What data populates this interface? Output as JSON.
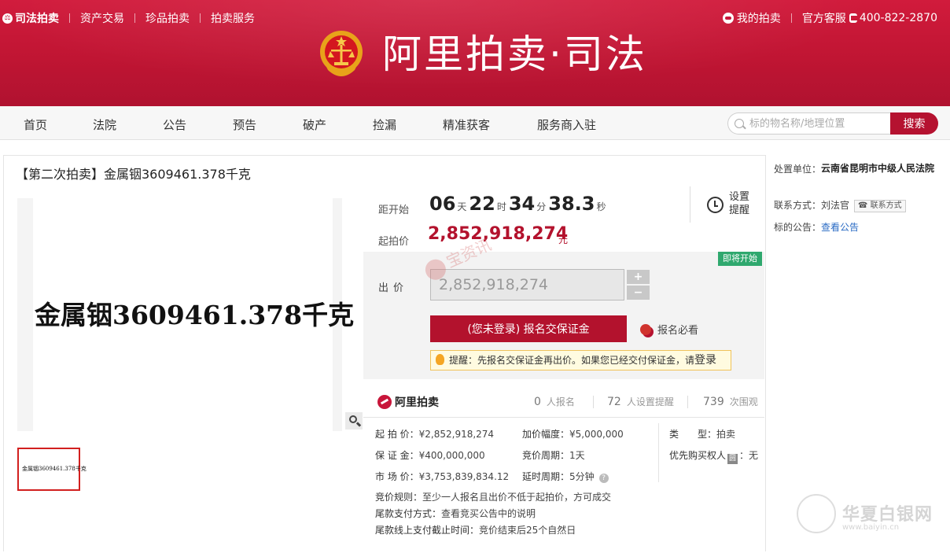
{
  "top_links": {
    "brand": "司法拍卖",
    "items": [
      "资产交易",
      "珍品拍卖",
      "拍卖服务"
    ]
  },
  "top_right": {
    "my_auction": "我的拍卖",
    "service": "官方客服",
    "phone": "400-822-2870"
  },
  "logo_title": "阿里拍卖·司法",
  "nav": [
    "首页",
    "法院",
    "公告",
    "预告",
    "破产",
    "捡漏",
    "精准获客",
    "服务商入驻"
  ],
  "search": {
    "placeholder": "标的物名称/地理位置",
    "button": "搜索"
  },
  "item": {
    "title": "【第二次拍卖】金属铟3609461.378千克",
    "image_text": "金属铟3609461.378千克",
    "thumb_text": "金属铟3609461.378千克"
  },
  "countdown": {
    "label": "距开始",
    "days": "06",
    "days_unit": "天",
    "hours": "22",
    "hours_unit": "时",
    "minutes": "34",
    "minutes_unit": "分",
    "seconds": "38.3",
    "seconds_unit": "秒"
  },
  "reminder": "设置提醒",
  "start_price": {
    "label": "起拍价",
    "value": "2,852,918,274",
    "unit": "元"
  },
  "status_badge": "即将开始",
  "bid": {
    "label": "出价",
    "value": "2,852,918,274",
    "plus": "+",
    "minus": "−"
  },
  "watermark_text": "宝资讯",
  "register_button": "(您未登录) 报名交保证金",
  "must_read": "报名必看",
  "tip": {
    "prefix": "提醒：",
    "text": "先报名交保证金再出价。如果您已经交付保证金，请",
    "link": "登录"
  },
  "ali_logo": "阿里拍卖",
  "stats": [
    {
      "num": "0",
      "label": "人报名"
    },
    {
      "num": "72",
      "label": "人设置提醒"
    },
    {
      "num": "739",
      "label": "次围观"
    }
  ],
  "info": {
    "start_price": {
      "k": "起 拍 价：",
      "v": "¥2,852,918,274"
    },
    "deposit": {
      "k": "保 证 金：",
      "v": "¥400,000,000"
    },
    "market_price": {
      "k": "市 场 价：",
      "v": "¥3,753,839,834.12"
    },
    "increment": {
      "k": "加价幅度：",
      "v": "¥5,000,000"
    },
    "period": {
      "k": "竞价周期：",
      "v": "1天"
    },
    "delay": {
      "k": "延时周期：",
      "v": "5分钟"
    },
    "type": {
      "k": "类　　型：",
      "v": "拍卖"
    },
    "priority": {
      "k": "优先购买权人",
      "icon": "圆",
      "v": "：无"
    },
    "rule": {
      "k": "竞价规则：",
      "v": "至少一人报名且出价不低于起拍价，方可成交"
    },
    "payment": {
      "k": "尾款支付方式：",
      "v": "查看竞买公告中的说明"
    },
    "deadline": {
      "k": "尾款线上支付截止时间：",
      "v": "竞价结束后25个自然日"
    }
  },
  "side": {
    "unit_label": "处置单位：",
    "unit_value": "云南省昆明市中级人民法院",
    "contact_label": "联系方式：",
    "contact_value": "刘法官",
    "contact_tag": "联系方式",
    "notice_label": "标的公告：",
    "notice_link": "查看公告"
  },
  "corner_watermark": {
    "text": "华夏白银网",
    "url": "www.baiyin.cn"
  },
  "colors": {
    "brand_red": "#c8163a",
    "price_red": "#b3122d",
    "badge_green": "#2fa86e",
    "link_blue": "#2a6bc4"
  }
}
